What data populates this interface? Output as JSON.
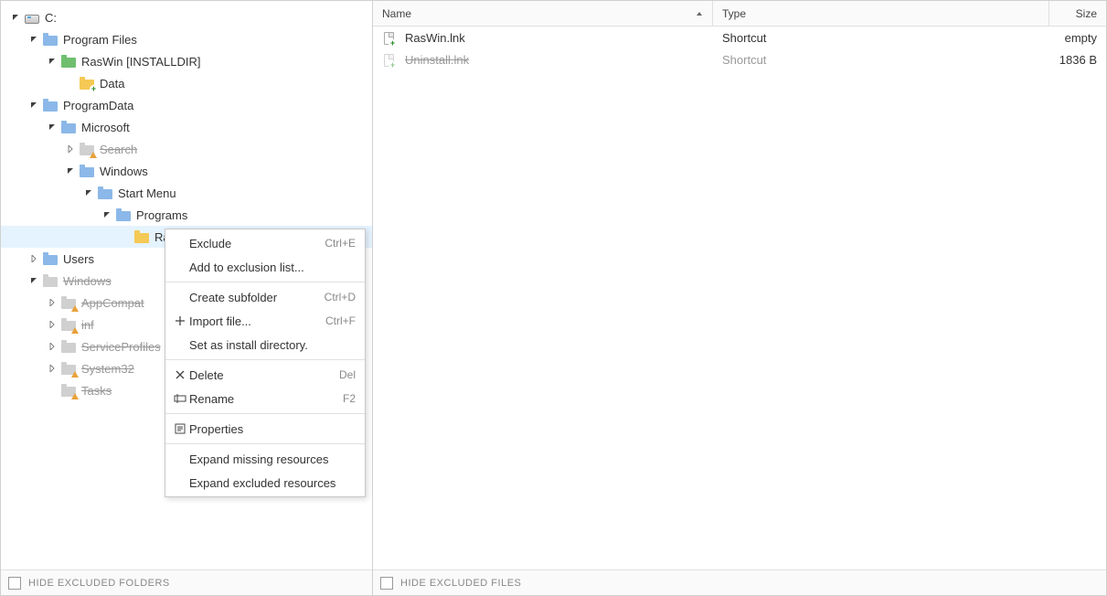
{
  "tree": [
    {
      "label": "C:",
      "indent": 0,
      "icon": "drive",
      "expander": "down",
      "struck": false
    },
    {
      "label": "Program Files",
      "indent": 1,
      "icon": "folder-blue",
      "expander": "down",
      "struck": false
    },
    {
      "label": "RasWin [INSTALLDIR]",
      "indent": 2,
      "icon": "folder-green",
      "expander": "down",
      "struck": false
    },
    {
      "label": "Data",
      "indent": 3,
      "icon": "folder-yellow-plus",
      "expander": "none",
      "struck": false
    },
    {
      "label": "ProgramData",
      "indent": 1,
      "icon": "folder-blue",
      "expander": "down",
      "struck": false
    },
    {
      "label": "Microsoft",
      "indent": 2,
      "icon": "folder-blue",
      "expander": "down",
      "struck": false
    },
    {
      "label": "Search",
      "indent": 3,
      "icon": "folder-warn",
      "expander": "right",
      "struck": true
    },
    {
      "label": "Windows",
      "indent": 3,
      "icon": "folder-blue",
      "expander": "down",
      "struck": false
    },
    {
      "label": "Start Menu",
      "indent": 4,
      "icon": "folder-blue",
      "expander": "down",
      "struck": false
    },
    {
      "label": "Programs",
      "indent": 5,
      "icon": "folder-blue",
      "expander": "down",
      "struck": false
    },
    {
      "label": "Ra",
      "indent": 6,
      "icon": "folder-yellow",
      "expander": "none",
      "struck": false,
      "selected": true
    },
    {
      "label": "Users",
      "indent": 1,
      "icon": "folder-blue",
      "expander": "right",
      "struck": false
    },
    {
      "label": "Windows",
      "indent": 1,
      "icon": "folder-grey",
      "expander": "down",
      "struck": true
    },
    {
      "label": "AppCompat",
      "indent": 2,
      "icon": "folder-warn",
      "expander": "right",
      "struck": true
    },
    {
      "label": "inf",
      "indent": 2,
      "icon": "folder-warn",
      "expander": "right",
      "struck": true
    },
    {
      "label": "ServiceProfiles",
      "indent": 2,
      "icon": "folder-grey",
      "expander": "right",
      "struck": true
    },
    {
      "label": "System32",
      "indent": 2,
      "icon": "folder-warn",
      "expander": "right",
      "struck": true
    },
    {
      "label": "Tasks",
      "indent": 2,
      "icon": "folder-warn",
      "expander": "none",
      "struck": true
    }
  ],
  "left_footer": {
    "checkbox_label": "HIDE EXCLUDED FOLDERS"
  },
  "columns": {
    "name": "Name",
    "type": "Type",
    "size": "Size"
  },
  "files": [
    {
      "name": "RasWin.lnk",
      "type": "Shortcut",
      "size": "empty",
      "struck": false,
      "overlay": "plus"
    },
    {
      "name": "Uninstall.lnk",
      "type": "Shortcut",
      "size": "1836 B",
      "struck": true,
      "overlay": "plus"
    }
  ],
  "right_footer": {
    "checkbox_label": "HIDE EXCLUDED FILES"
  },
  "context_menu": [
    {
      "kind": "item",
      "label": "Exclude",
      "shortcut": "Ctrl+E",
      "icon": ""
    },
    {
      "kind": "item",
      "label": "Add to exclusion list...",
      "shortcut": "",
      "icon": ""
    },
    {
      "kind": "sep"
    },
    {
      "kind": "item",
      "label": "Create subfolder",
      "shortcut": "Ctrl+D",
      "icon": ""
    },
    {
      "kind": "item",
      "label": "Import file...",
      "shortcut": "Ctrl+F",
      "icon": "plus"
    },
    {
      "kind": "item",
      "label": "Set as install directory.",
      "shortcut": "",
      "icon": ""
    },
    {
      "kind": "sep"
    },
    {
      "kind": "item",
      "label": "Delete",
      "shortcut": "Del",
      "icon": "x"
    },
    {
      "kind": "item",
      "label": "Rename",
      "shortcut": "F2",
      "icon": "rename"
    },
    {
      "kind": "sep"
    },
    {
      "kind": "item",
      "label": "Properties",
      "shortcut": "",
      "icon": "props"
    },
    {
      "kind": "sep"
    },
    {
      "kind": "item",
      "label": "Expand missing resources",
      "shortcut": "",
      "icon": ""
    },
    {
      "kind": "item",
      "label": "Expand excluded resources",
      "shortcut": "",
      "icon": ""
    }
  ]
}
